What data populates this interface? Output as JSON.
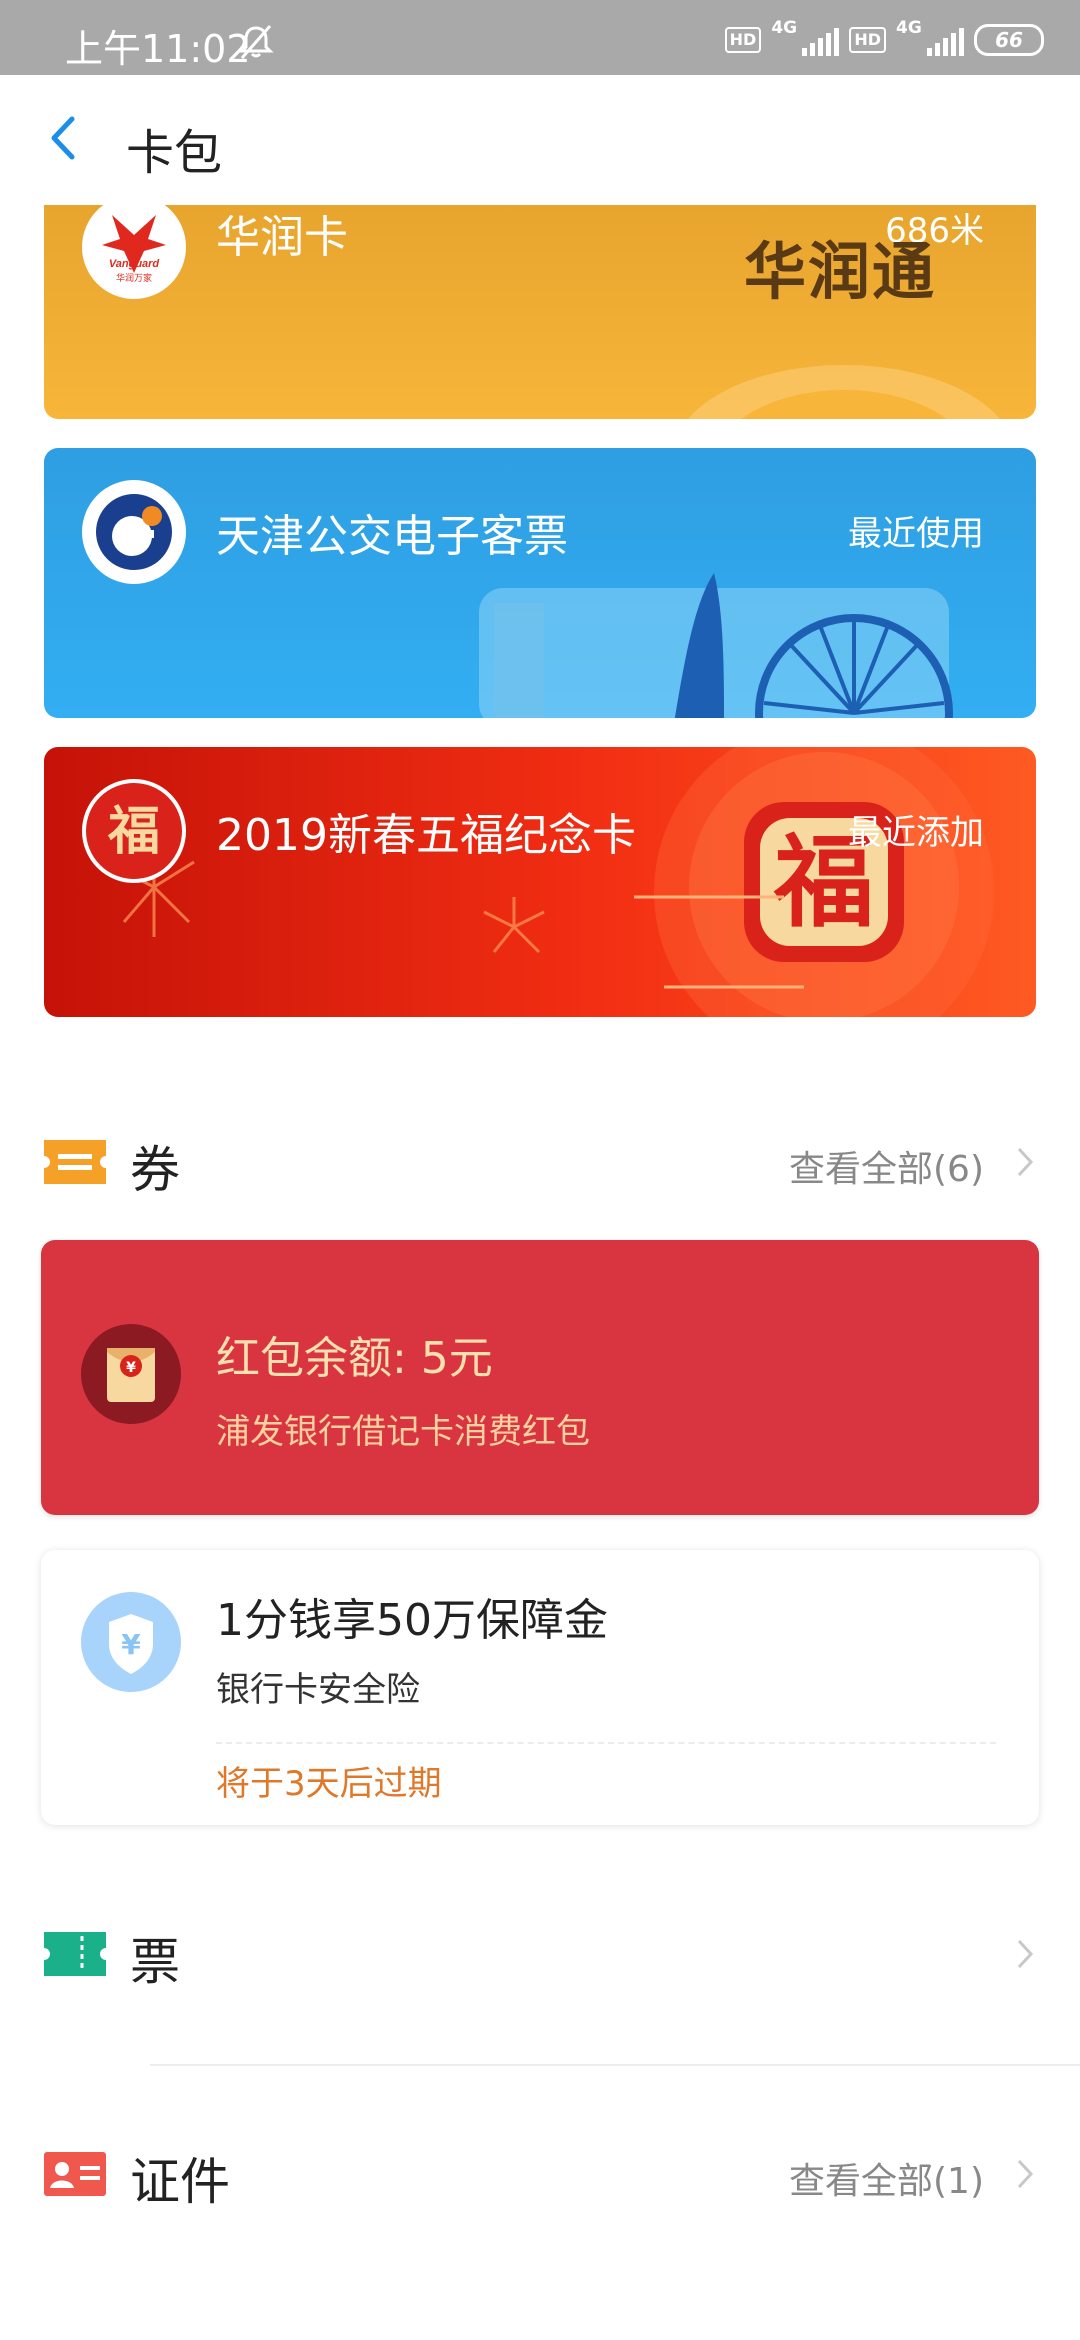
{
  "status_bar": {
    "time": "上午11:02",
    "hd1": "HD",
    "net1": "4G",
    "hd2": "HD",
    "net2": "4G",
    "battery": "66"
  },
  "header": {
    "title": "卡包"
  },
  "cards": [
    {
      "title": "华润卡",
      "right_text": "686米",
      "brand_text": "华润通",
      "logo": "vanguard-logo",
      "logo_text": "Vanguard",
      "logo_subtext": "华润万家",
      "color": "#f2b035"
    },
    {
      "title": "天津公交电子客票",
      "right_text": "最近使用",
      "logo": "tianjin-bus-logo",
      "color": "#2fa5ea"
    },
    {
      "title": "2019新春五福纪念卡",
      "right_text": "最近添加",
      "logo": "fu-logo",
      "logo_text": "福",
      "emblem_text": "福",
      "color": "#e82a12"
    }
  ],
  "coupons_section": {
    "icon": "ticket-icon",
    "title": "券",
    "link": "查看全部(6)",
    "items": [
      {
        "title": "红包余额: 5元",
        "subtitle": "浦发银行借记卡消费红包",
        "icon": "red-envelope-icon",
        "icon_text": "¥",
        "bg": "#d93541"
      },
      {
        "title": "1分钱享50万保障金",
        "subtitle": "银行卡安全险",
        "expiry": "将于3天后过期",
        "icon": "shield-yen-icon",
        "icon_text": "¥",
        "expiry_color": "#e0782a"
      }
    ]
  },
  "tickets_section": {
    "icon": "ticket-stub-icon",
    "title": "票"
  },
  "documents_section": {
    "icon": "id-card-icon",
    "title": "证件",
    "link": "查看全部(1)"
  },
  "colors": {
    "accent_blue": "#1b8fe8",
    "coupon_icon_orange": "#f5a128",
    "ticket_green": "#19b08a",
    "id_red": "#f0574d"
  }
}
